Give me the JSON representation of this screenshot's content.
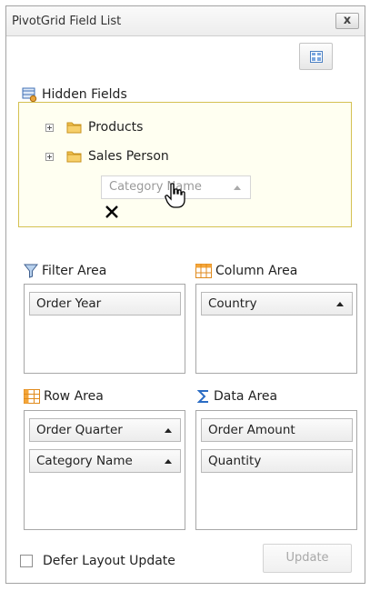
{
  "window": {
    "title": "PivotGrid Field List",
    "close_label": "x"
  },
  "hidden_fields": {
    "label": "Hidden Fields",
    "items": [
      {
        "label": "Products"
      },
      {
        "label": "Sales Person"
      }
    ],
    "dragging_field": {
      "label": "Category Name"
    }
  },
  "filter_area": {
    "label": "Filter Area",
    "fields": [
      {
        "label": "Order Year"
      }
    ]
  },
  "column_area": {
    "label": "Column Area",
    "fields": [
      {
        "label": "Country"
      }
    ]
  },
  "row_area": {
    "label": "Row Area",
    "fields": [
      {
        "label": "Order Quarter"
      },
      {
        "label": "Category Name"
      }
    ]
  },
  "data_area": {
    "label": "Data Area",
    "fields": [
      {
        "label": "Order Amount"
      },
      {
        "label": "Quantity"
      }
    ]
  },
  "footer": {
    "defer_label": "Defer Layout Update",
    "defer_checked": false,
    "update_label": "Update"
  },
  "icons": {
    "layout": "layout-grid-icon",
    "hidden_fields": "hidden-fields-icon",
    "folder": "folder-icon",
    "filter": "filter-funnel-icon",
    "column": "column-table-icon",
    "row": "row-table-icon",
    "data": "sigma-icon",
    "cursor": "hand-cursor-icon",
    "nodrop": "no-drop-x-icon"
  },
  "colors": {
    "hidden_box_border": "#d4c152",
    "hidden_box_bg": "#fffff1",
    "folder": "#f2c14e"
  }
}
